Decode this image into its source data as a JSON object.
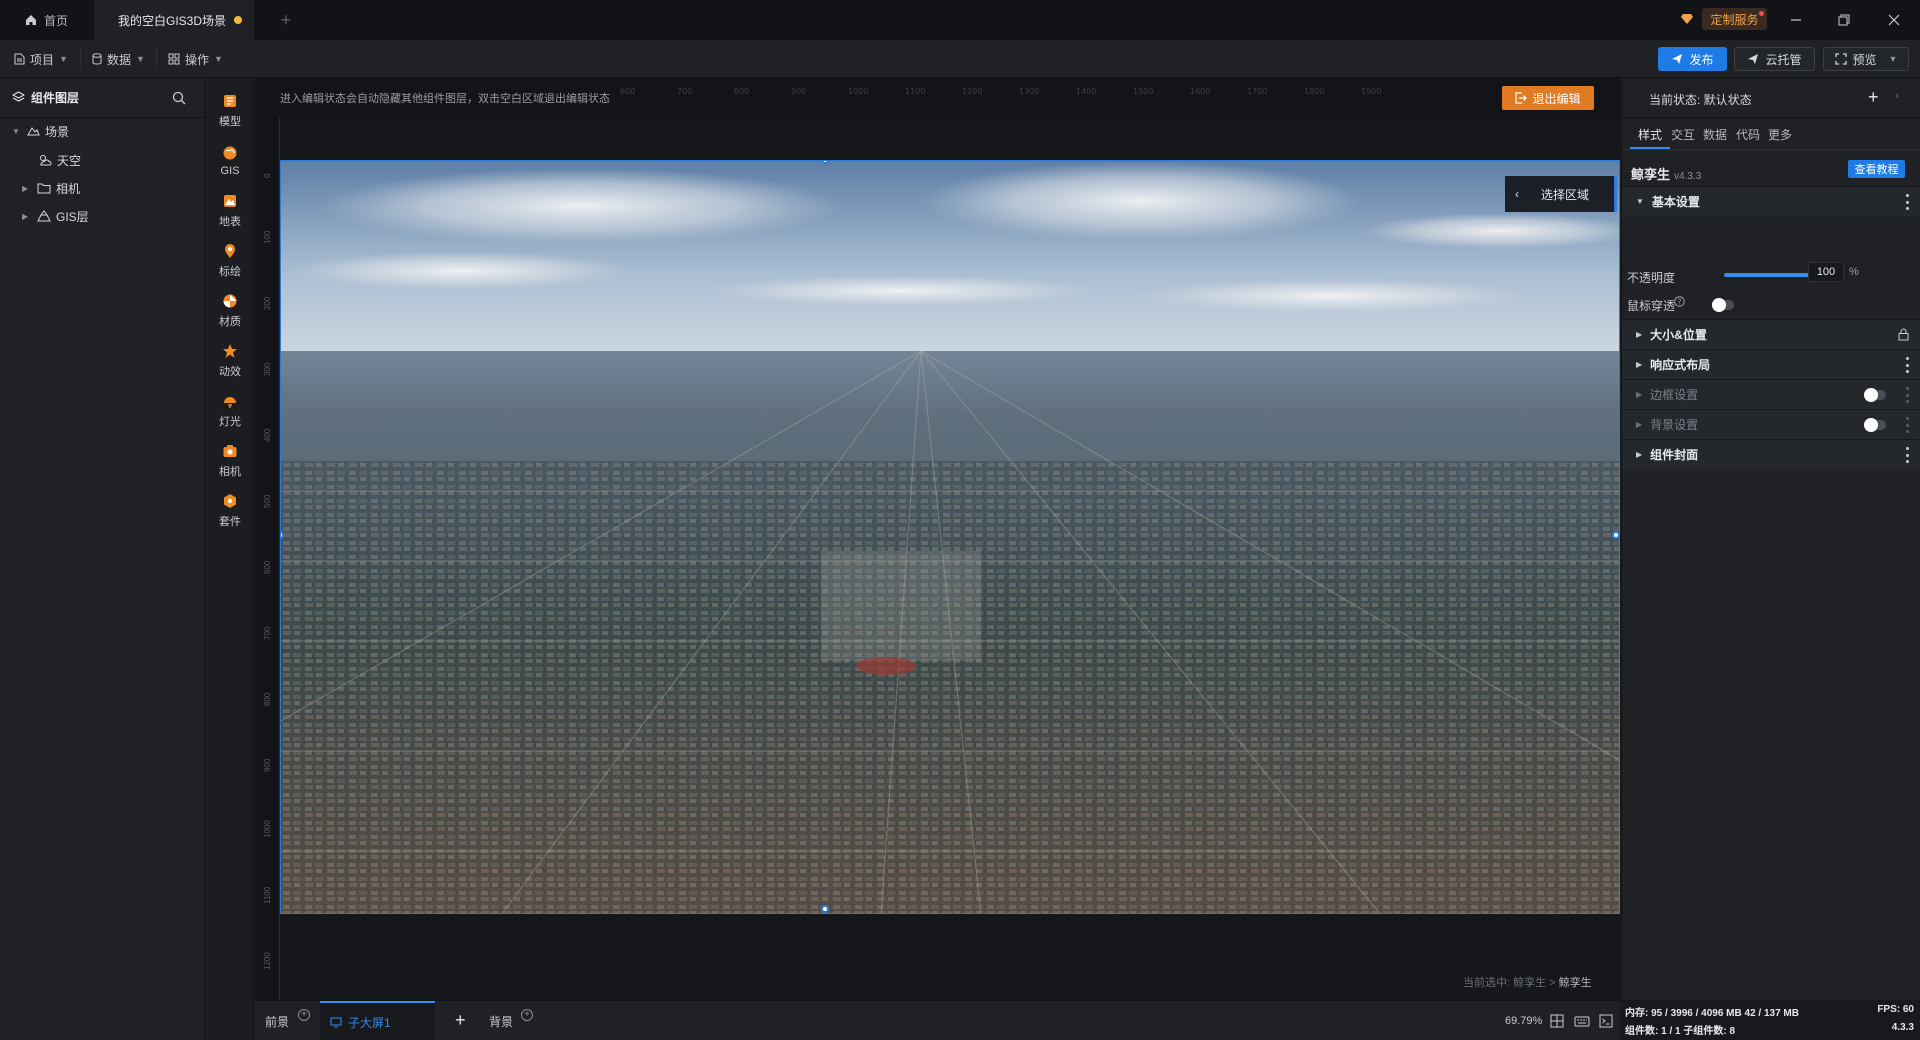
{
  "tabs": {
    "home": "首页",
    "scene": "我的空白GIS3D场景",
    "add": "+"
  },
  "titlebar": {
    "custom_service": "定制服务"
  },
  "menu": {
    "project": "项目",
    "data": "数据",
    "operation": "操作"
  },
  "actions": {
    "publish": "发布",
    "cloud": "云托管",
    "preview": "预览"
  },
  "layers": {
    "title": "组件图层",
    "items": [
      {
        "label": "场景",
        "icon": "scene-icon",
        "expanded": true
      },
      {
        "label": "天空",
        "icon": "sky-icon"
      },
      {
        "label": "相机",
        "icon": "folder-icon"
      },
      {
        "label": "GIS层",
        "icon": "gis-layer-icon"
      }
    ]
  },
  "tools": [
    {
      "label": "模型",
      "icon": "model-icon"
    },
    {
      "label": "GIS",
      "icon": "gis-icon"
    },
    {
      "label": "地表",
      "icon": "terrain-icon"
    },
    {
      "label": "标绘",
      "icon": "pin-icon"
    },
    {
      "label": "材质",
      "icon": "material-icon"
    },
    {
      "label": "动效",
      "icon": "effect-icon"
    },
    {
      "label": "灯光",
      "icon": "light-icon"
    },
    {
      "label": "相机",
      "icon": "camera-icon"
    },
    {
      "label": "套件",
      "icon": "kit-icon"
    }
  ],
  "canvas": {
    "hint": "进入编辑状态会自动隐藏其他组件图层，双击空白区域退出编辑状态",
    "exit_edit": "退出编辑",
    "select_area": "选择区域",
    "status_prefix": "当前选中: ",
    "status_path": "鲸孪生 > ",
    "status_current": "鲸孪生",
    "ruler_top": [
      "600",
      "700",
      "800",
      "900",
      "1000",
      "1100",
      "1200",
      "1300",
      "1400",
      "1500",
      "1600",
      "1700",
      "1800",
      "1900"
    ],
    "ruler_left": [
      "0",
      "100",
      "200",
      "300",
      "400",
      "500",
      "600",
      "700",
      "800",
      "900",
      "1000",
      "1100",
      "1200"
    ]
  },
  "bottom": {
    "foreground": "前景",
    "subscreen": "子大屏1",
    "background": "背景",
    "zoom": "69.79%"
  },
  "right": {
    "state_label": "当前状态:  默认状态",
    "tabs": [
      "样式",
      "交互",
      "数据",
      "代码",
      "更多"
    ],
    "component_name": "鲸孪生",
    "component_version": "v4.3.3",
    "tutorial": "查看教程",
    "sections": {
      "basic": "基本设置",
      "size_position": "大小&位置",
      "responsive": "响应式布局",
      "border": "边框设置",
      "bg": "背景设置",
      "cover": "组件封面"
    },
    "props": {
      "opacity_label": "不透明度",
      "opacity_value": "100",
      "opacity_unit": "%",
      "mouse_pass": "鼠标穿透"
    }
  },
  "stats": {
    "memory": "内存:  95 / 3996 / 4096 MB  42 / 137 MB",
    "fps": "FPS:  60",
    "components": "组件数: 1 / 1   子组件数: 8",
    "version": "4.3.3"
  },
  "colors": {
    "accent": "#1f7be6",
    "orange": "#e07a23",
    "selection": "#2d7bd6"
  }
}
